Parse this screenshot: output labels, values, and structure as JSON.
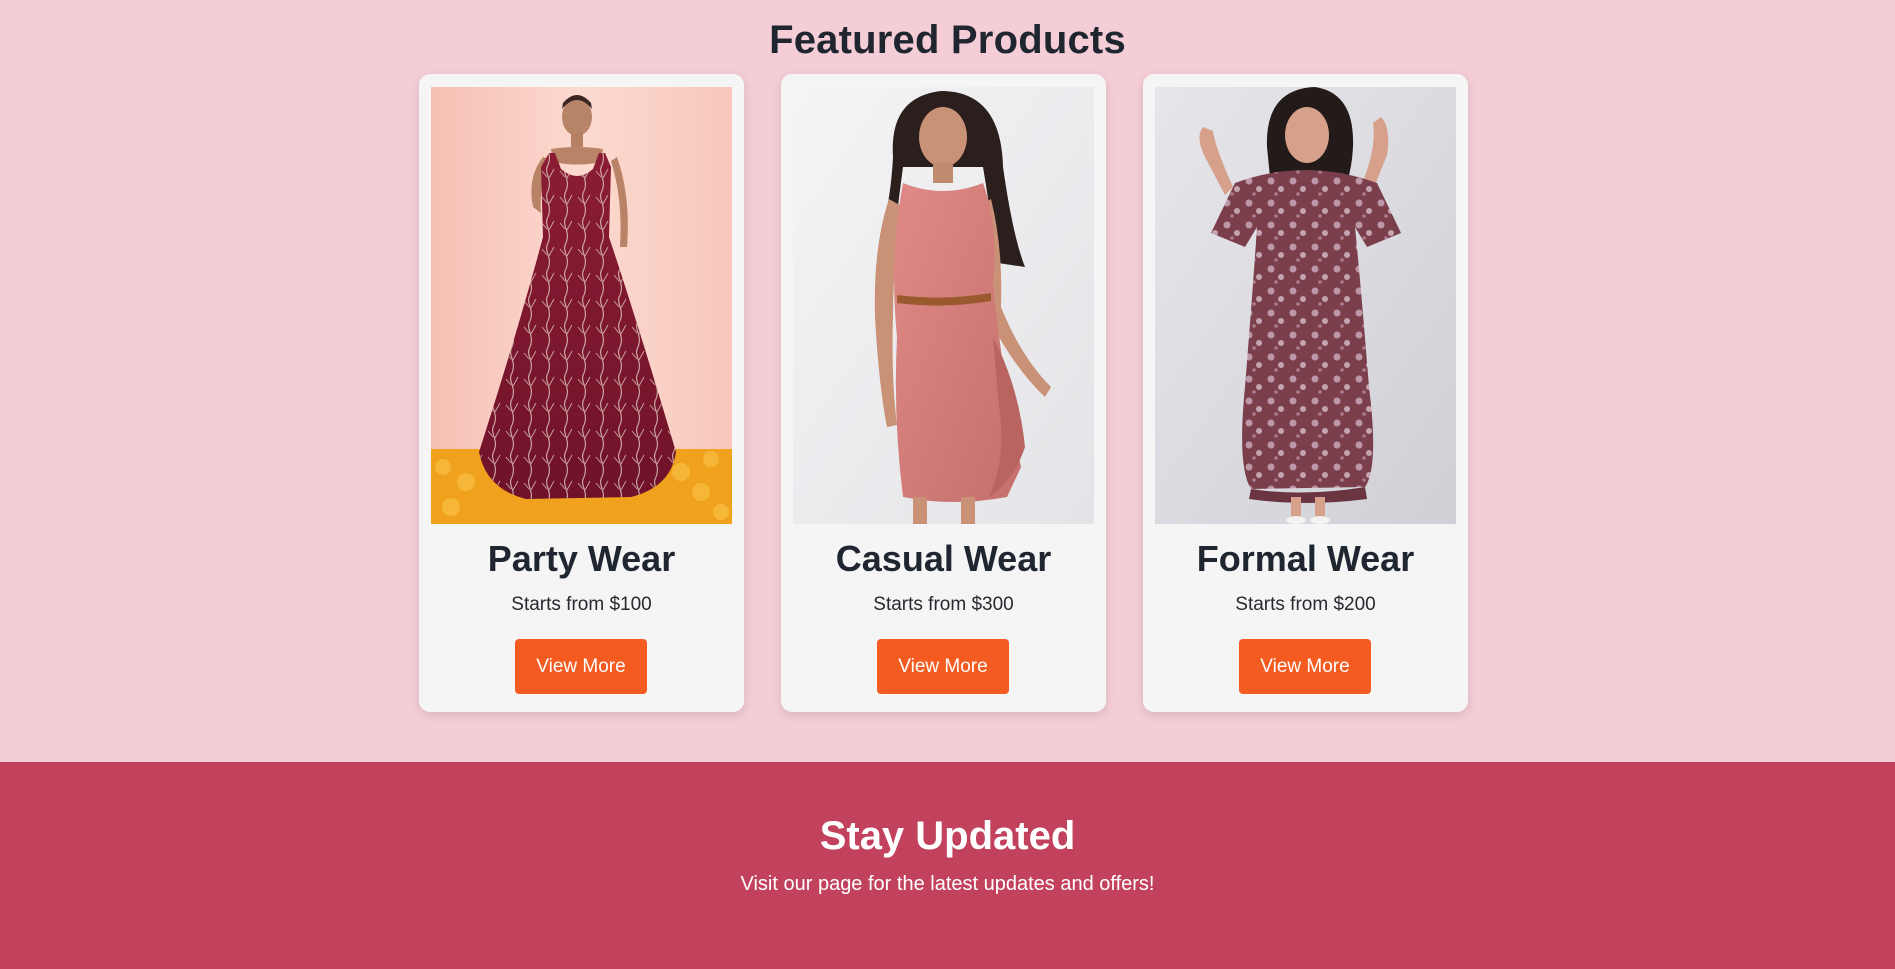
{
  "featured": {
    "title": "Featured Products",
    "products": [
      {
        "title": "Party Wear",
        "price_text": "Starts from $100",
        "button_label": "View More",
        "image": "maroon-sequin-gown-photo"
      },
      {
        "title": "Casual Wear",
        "price_text": "Starts from $300",
        "button_label": "View More",
        "image": "pink-ruffle-dress-photo"
      },
      {
        "title": "Formal Wear",
        "price_text": "Starts from $200",
        "button_label": "View More",
        "image": "floral-maxi-dress-photo"
      }
    ]
  },
  "newsletter": {
    "title": "Stay Updated",
    "text": "Visit our page for the latest updates and offers!"
  },
  "colors": {
    "page_background": "#f5cdd6",
    "card_background": "#f5f5f6",
    "button_accent": "#f45b21",
    "newsletter_background": "#c2425d",
    "heading_text": "#1f2630"
  }
}
